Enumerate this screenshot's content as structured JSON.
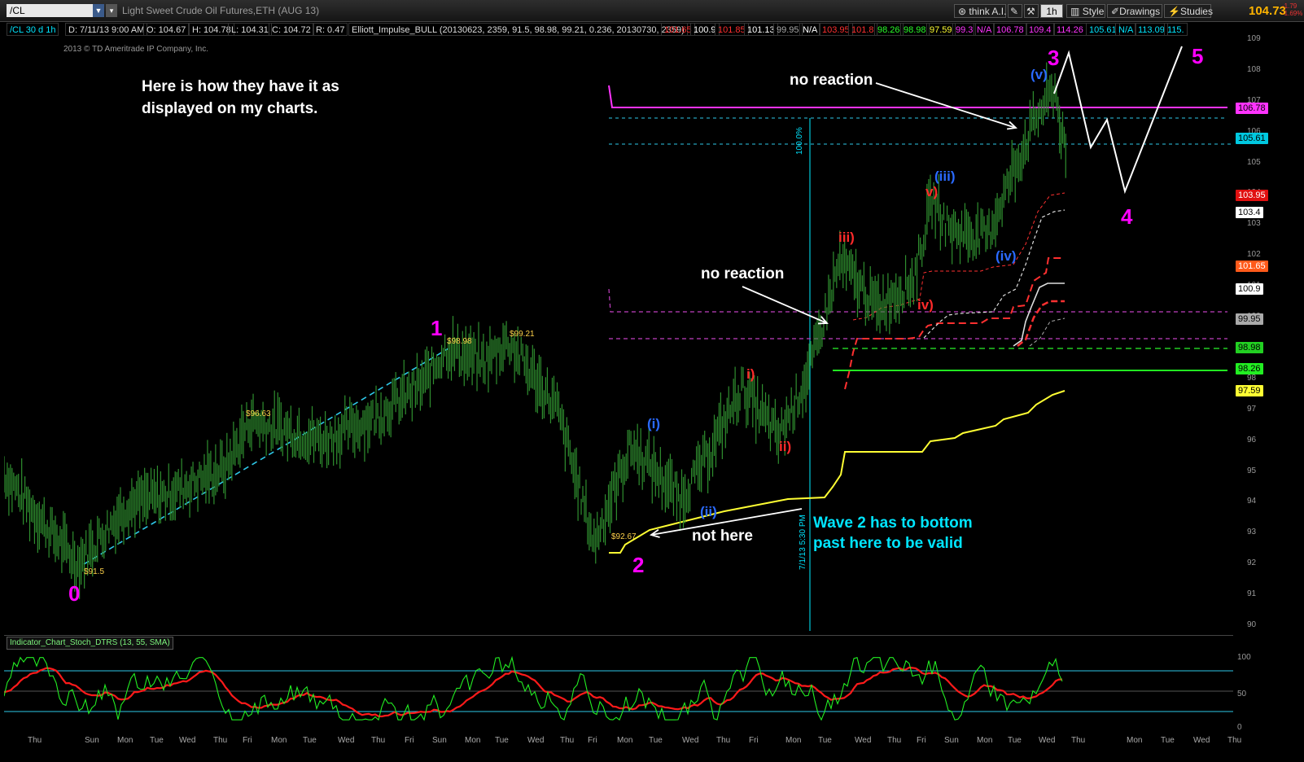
{
  "window": {
    "symbol": "/CL",
    "title": "Light Sweet Crude Oil Futures,ETH (AUG 13)",
    "toolbar": {
      "think": "think A.I.",
      "timeframe": "1h",
      "style": "Style",
      "drawings": "Drawings",
      "studies": "Studies"
    },
    "last_price": "104.73",
    "change": "-1.79",
    "change_pct": "-1.69%"
  },
  "infobar": {
    "chart_desc": "/CL 30 d 1h",
    "date": "D: 7/11/13 9:00 AM",
    "open": "O: 104.67",
    "high": "H: 104.78",
    "low": "L: 104.31",
    "close": "C: 104.72",
    "range": "R: 0.47",
    "study": "Elliott_Impulse_BULL (20130623, 2359, 91.5, 98.98, 99.21, 0.236, 20130730, 2359)",
    "values": [
      {
        "v": "101.65",
        "c": "#ff3030"
      },
      {
        "v": "100.9",
        "c": "#ffffff"
      },
      {
        "v": "101.85",
        "c": "#ff3030"
      },
      {
        "v": "101.13",
        "c": "#ffffff"
      },
      {
        "v": "99.95",
        "c": "#aaaaaa"
      },
      {
        "v": "N/A",
        "c": "#ffffff"
      },
      {
        "v": "103.95",
        "c": "#ff3030"
      },
      {
        "v": "101.8",
        "c": "#ff3030"
      },
      {
        "v": "98.26",
        "c": "#2aff2a"
      },
      {
        "v": "98.98",
        "c": "#2aff2a"
      },
      {
        "v": "97.59",
        "c": "#ffff33"
      },
      {
        "v": "99.3",
        "c": "#ff33ff"
      },
      {
        "v": "N/A",
        "c": "#ff33ff"
      },
      {
        "v": "106.78",
        "c": "#ff33ff"
      },
      {
        "v": "109.4",
        "c": "#ff33ff"
      },
      {
        "v": "114.26",
        "c": "#ff33ff"
      },
      {
        "v": "105.61",
        "c": "#00e5ff"
      },
      {
        "v": "N/A",
        "c": "#00e5ff"
      },
      {
        "v": "113.09",
        "c": "#00e5ff"
      },
      {
        "v": "115.",
        "c": "#00e5ff"
      }
    ]
  },
  "copyright": "2013 © TD Ameritrade IP Company, Inc.",
  "annotations": {
    "intro": "Here is how they have it as",
    "intro2": "displayed on my charts.",
    "no_reaction": "no reaction",
    "not_here": "not here",
    "wave2_note1": "Wave 2 has to bottom",
    "wave2_note2": "past here to be valid",
    "vline_date": "7/1/13 5:30 PM",
    "fib_pct": "100.0%"
  },
  "wave_labels": {
    "w0": "0",
    "w1": "1",
    "w2": "2",
    "w3": "3",
    "w4": "4",
    "w5": "5",
    "i": "i)",
    "ii": "ii)",
    "iii": "iii)",
    "iv": "iv)",
    "v": "v)",
    "pi": "(i)",
    "pii": "(ii)",
    "piii": "(iii)",
    "piv": "(iv)",
    "pv": "(v)"
  },
  "price_labels": {
    "p915": "$91.5",
    "p9663": "$96.63",
    "p9898": "$98.98",
    "p9921": "$99.21",
    "p9267": "$92.67"
  },
  "price_tags": [
    {
      "v": "106.78",
      "bg": "#ff33ff",
      "fg": "#000"
    },
    {
      "v": "105.61",
      "bg": "#00c8e0",
      "fg": "#000"
    },
    {
      "v": "103.95",
      "bg": "#e01010",
      "fg": "#fff"
    },
    {
      "v": "103.4",
      "bg": "#ffffff",
      "fg": "#000"
    },
    {
      "v": "101.65",
      "bg": "#ff5a1a",
      "fg": "#fff"
    },
    {
      "v": "100.9",
      "bg": "#ffffff",
      "fg": "#000"
    },
    {
      "v": "99.95",
      "bg": "#aaaaaa",
      "fg": "#000"
    },
    {
      "v": "98.98",
      "bg": "#22d022",
      "fg": "#000"
    },
    {
      "v": "98.26",
      "bg": "#22ee22",
      "fg": "#000"
    },
    {
      "v": "97.59",
      "bg": "#ffff33",
      "fg": "#000"
    }
  ],
  "axis": {
    "price_ticks": [
      "109",
      "108",
      "107",
      "106",
      "105",
      "104",
      "103",
      "102",
      "101",
      "100",
      "99",
      "98",
      "97",
      "96",
      "95",
      "94",
      "93",
      "92",
      "91",
      "90"
    ],
    "ind_ticks": [
      "100",
      "50",
      "0"
    ],
    "x_ticks": [
      "Thu",
      "Sun",
      "Mon",
      "Tue",
      "Wed",
      "Thu",
      "Fri",
      "Mon",
      "Tue",
      "Wed",
      "Thu",
      "Fri",
      "Sun",
      "Mon",
      "Tue",
      "Wed",
      "Thu",
      "Fri",
      "Mon",
      "Tue",
      "Wed",
      "Thu",
      "Fri",
      "Mon",
      "Tue",
      "Wed",
      "Thu",
      "Fri",
      "Sun",
      "Mon",
      "Tue",
      "Wed",
      "Thu",
      "Mon",
      "Tue",
      "Wed",
      "Thu"
    ]
  },
  "indicator": {
    "label": "Indicator_Chart_Stoch_DTRS (13, 55, SMA)"
  },
  "chart_data": {
    "type": "line",
    "title": "Light Sweet Crude Oil Futures,ETH (AUG 13)",
    "xlabel": "",
    "ylabel": "",
    "ylim": [
      90,
      109.5
    ],
    "series": [
      {
        "name": "/CL",
        "points": [
          [
            0,
            94.9
          ],
          [
            0.03,
            93.4
          ],
          [
            0.06,
            92.0
          ],
          [
            0.1,
            93.9
          ],
          [
            0.13,
            94.2
          ],
          [
            0.18,
            95.1
          ],
          [
            0.2,
            96.63
          ],
          [
            0.26,
            96.0
          ],
          [
            0.3,
            96.7
          ],
          [
            0.34,
            97.8
          ],
          [
            0.36,
            98.98
          ],
          [
            0.39,
            98.5
          ],
          [
            0.41,
            99.21
          ],
          [
            0.45,
            97.0
          ],
          [
            0.48,
            92.67
          ],
          [
            0.51,
            95.8
          ],
          [
            0.53,
            95.0
          ],
          [
            0.55,
            94.1
          ],
          [
            0.57,
            95.3
          ],
          [
            0.6,
            97.7
          ],
          [
            0.63,
            96.1
          ],
          [
            0.655,
            98.2
          ],
          [
            0.68,
            101.8
          ],
          [
            0.71,
            100.3
          ],
          [
            0.74,
            101.2
          ],
          [
            0.755,
            103.8
          ],
          [
            0.77,
            102.8
          ],
          [
            0.8,
            102.6
          ],
          [
            0.82,
            104.6
          ],
          [
            0.84,
            106.5
          ],
          [
            0.855,
            107.4
          ],
          [
            0.865,
            104.7
          ]
        ]
      },
      {
        "name": "projection",
        "points": [
          [
            0.865,
            107.4
          ],
          [
            0.885,
            105.5
          ],
          [
            0.9,
            106.2
          ],
          [
            0.91,
            103.9
          ],
          [
            0.96,
            109.3
          ]
        ]
      }
    ]
  }
}
